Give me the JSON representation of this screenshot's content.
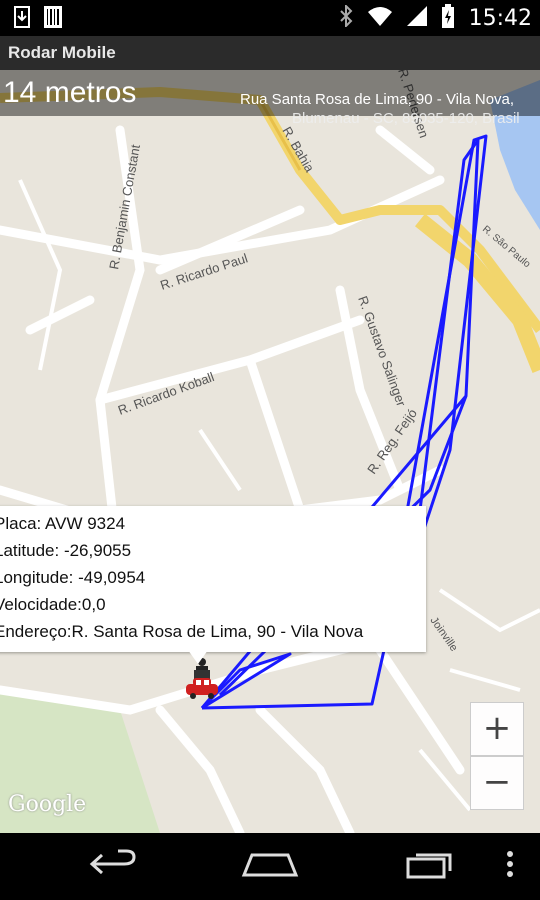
{
  "status_bar": {
    "time": "15:42",
    "icons": [
      "download-icon",
      "barcode-icon",
      "bluetooth-icon",
      "wifi-icon",
      "signal-icon",
      "battery-icon"
    ]
  },
  "app": {
    "title": "Rodar Mobile"
  },
  "map": {
    "distance": "14 metros",
    "address": "Rua Santa Rosa de Lima, 90 - Vila Nova,",
    "address_cut": "Blumenau - SC, 89035-120, Brasil",
    "street_labels": [
      "R. Benjamin Constant",
      "R. Ricardo Paul",
      "R. Bahia",
      "R. Gustavo Salinger",
      "R. Ricardo Koball",
      "R. Reg. Feijó",
      "R. Pedersen",
      "R. São Paulo",
      "Joinville"
    ],
    "route_color": "#1a1aff",
    "google_logo": "Google"
  },
  "info_window": {
    "placa": "Placa: AVW 9324",
    "latitude": "Latitude: -26,9055",
    "longitude": "Longitude: -49,0954",
    "velocidade": "Velocidade:0,0",
    "endereco": "Endereço:R. Santa Rosa de Lima, 90 - Vila Nova"
  },
  "zoom": {
    "in": "+",
    "out": "−"
  },
  "nav_bar": {
    "icons": [
      "back-icon",
      "home-icon",
      "recents-icon",
      "menu-icon"
    ]
  }
}
